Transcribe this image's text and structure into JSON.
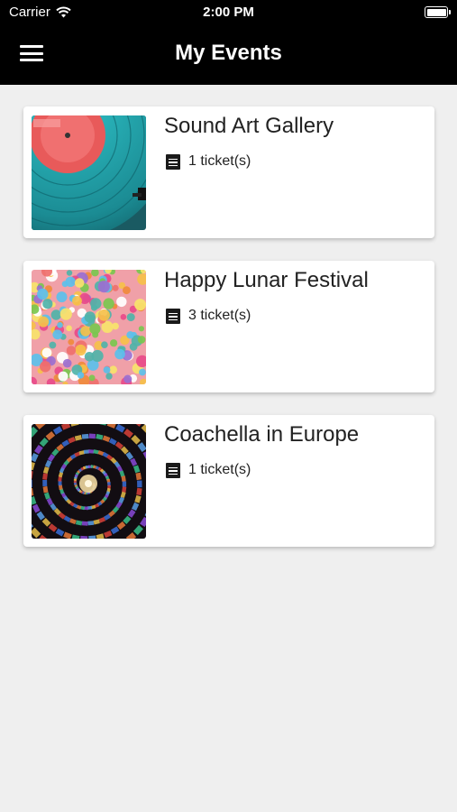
{
  "status_bar": {
    "carrier": "Carrier",
    "time": "2:00 PM"
  },
  "header": {
    "title": "My Events",
    "menu_icon": "hamburger-menu-icon"
  },
  "events": [
    {
      "title": "Sound Art Gallery",
      "tickets": "1 ticket(s)",
      "image": "vinyl-record"
    },
    {
      "title": "Happy Lunar Festival",
      "tickets": "3 ticket(s)",
      "image": "confetti"
    },
    {
      "title": "Coachella in Europe",
      "tickets": "1 ticket(s)",
      "image": "stained-glass-spiral"
    }
  ],
  "colors": {
    "header_bg": "#000000",
    "page_bg": "#efefef",
    "card_bg": "#ffffff"
  }
}
